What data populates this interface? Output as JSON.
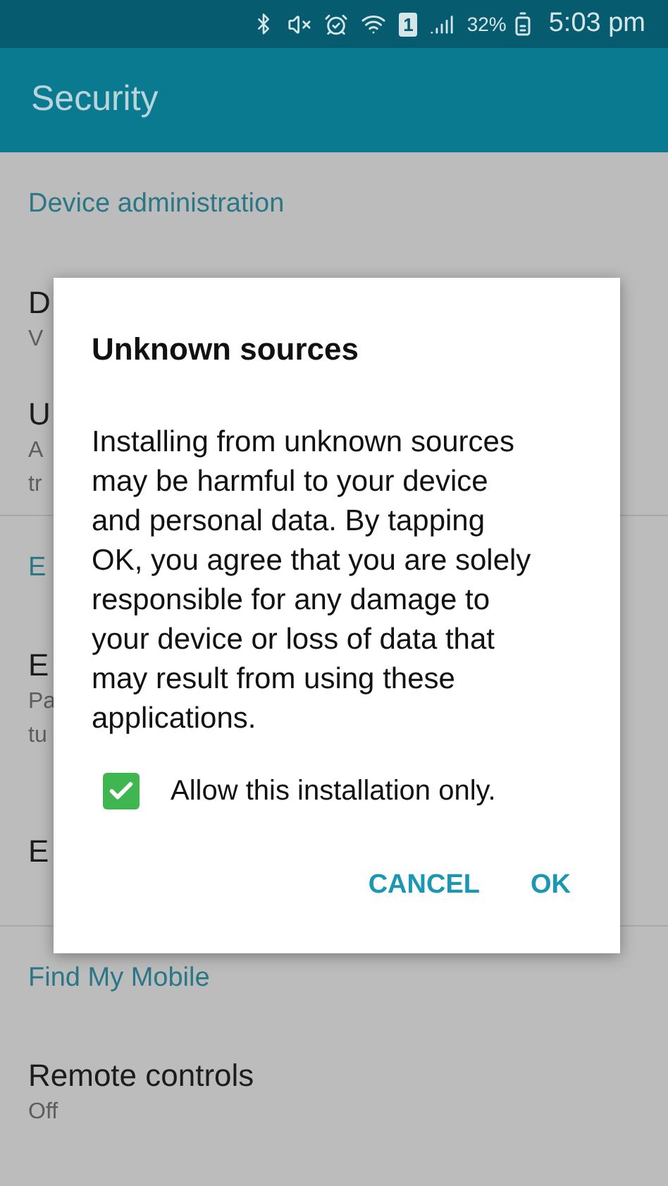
{
  "status_bar": {
    "sim": "1",
    "battery": "32%",
    "time": "5:03 pm"
  },
  "app_bar": {
    "title": "Security"
  },
  "sections": [
    {
      "header": "Device administration",
      "items": [
        {
          "title": "D",
          "summary": [
            "V"
          ]
        },
        {
          "title": "U",
          "summary": [
            "A",
            "tr"
          ]
        }
      ]
    },
    {
      "header": "E",
      "items": [
        {
          "title": "E",
          "summary": [
            "Pa",
            "tu"
          ]
        },
        {
          "title": "E"
        }
      ]
    },
    {
      "header": "Find My Mobile",
      "items": [
        {
          "title": "Remote controls",
          "summary": [
            "Off"
          ]
        }
      ]
    }
  ],
  "dialog": {
    "title": "Unknown sources",
    "message": "Installing from unknown sources may be harmful to your device and personal data. By tapping OK, you agree that you are solely responsible for any damage to your device or loss of data that may result from using these applications.",
    "checkbox": {
      "label": "Allow this installation only.",
      "checked": true
    },
    "buttons": [
      {
        "label": "CANCEL"
      },
      {
        "label": "OK"
      }
    ]
  }
}
